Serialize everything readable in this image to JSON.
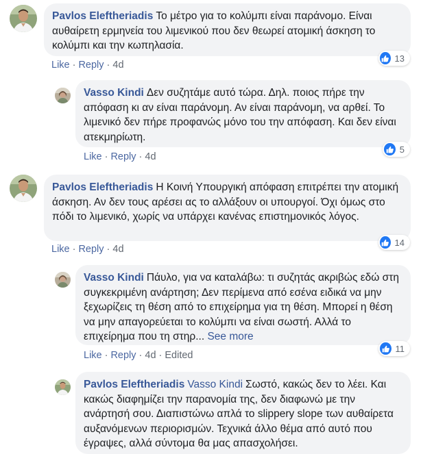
{
  "comments": [
    {
      "author": "Pavlos Eleftheriadis",
      "avatar": "pavlos-avatar",
      "mention": "",
      "text": "Το μέτρο για το κολύμπι είναι παράνομο. Είναι αυθαίρετη ερμηνεία του λιμενικού που δεν θεωρεί ατομική άσκηση το κολύμπι και την κωπηλασία.",
      "see_more": "",
      "actions": {
        "like": "Like",
        "reply": "Reply",
        "age": "4d",
        "edited": ""
      },
      "reactions": "13"
    },
    {
      "author": "Vasso Kindi",
      "avatar": "vasso-avatar",
      "mention": "",
      "text": "Δεν συζητάμε αυτό τώρα. Δηλ. ποιος πήρε την απόφαση κι αν είναι παράνομη. Αν είναι παράνομη, να αρθεί. Το λιμενικό δεν πήρε προφανώς μόνο του την απόφαση. Και δεν είναι ατεκμηρίωτη.",
      "see_more": "",
      "actions": {
        "like": "Like",
        "reply": "Reply",
        "age": "4d",
        "edited": ""
      },
      "reactions": "5"
    },
    {
      "author": "Pavlos Eleftheriadis",
      "avatar": "pavlos-avatar",
      "mention": "",
      "text": "Η Κοινή Υπουργική απόφαση επιτρέπει την ατομική άσκηση. Αν δεν τους αρέσει ας το αλλάξουν οι υπουργοί. Όχι όμως στο πόδι το λιμενικό, χωρίς να υπάρχει κανένας επιστημονικός λόγος.",
      "see_more": "",
      "actions": {
        "like": "Like",
        "reply": "Reply",
        "age": "4d",
        "edited": ""
      },
      "reactions": "14"
    },
    {
      "author": "Vasso Kindi",
      "avatar": "vasso-avatar",
      "mention": "",
      "text": "Πάυλο, για να καταλάβω: τι συζητάς ακριβώς εδώ στη συγκεκριμένη ανάρτηση; Δεν περίμενα από εσένα ειδικά να μην ξεχωρίζεις τη θέση από το επιχείρημα για τη θέση. Μπορεί η θέση να μην απαγορεύεται το κολύμπι να είναι σωστή. Αλλά το επιχείρημα που τη στηρ...",
      "see_more": "See more",
      "actions": {
        "like": "Like",
        "reply": "Reply",
        "age": "4d",
        "edited": "Edited"
      },
      "reactions": "11"
    },
    {
      "author": "Pavlos Eleftheriadis",
      "avatar": "pavlos-avatar",
      "mention": "Vasso Kindi",
      "text": "Σωστό, κακώς δεν το λέει. Και κακώς διαφημίζει την παρανομία της, δεν διαφωνώ με την ανάρτησή σου. Διαπιστώνω απλά το slippery slope των αυθαίρετα αυξανόμενων περιορισμών. Τεχνικά άλλο θέμα από αυτό που έγραψες, αλλά σύντομα θα μας απασχολήσει.",
      "see_more": "",
      "actions": {
        "like": "",
        "reply": "",
        "age": "",
        "edited": ""
      },
      "reactions": ""
    }
  ]
}
